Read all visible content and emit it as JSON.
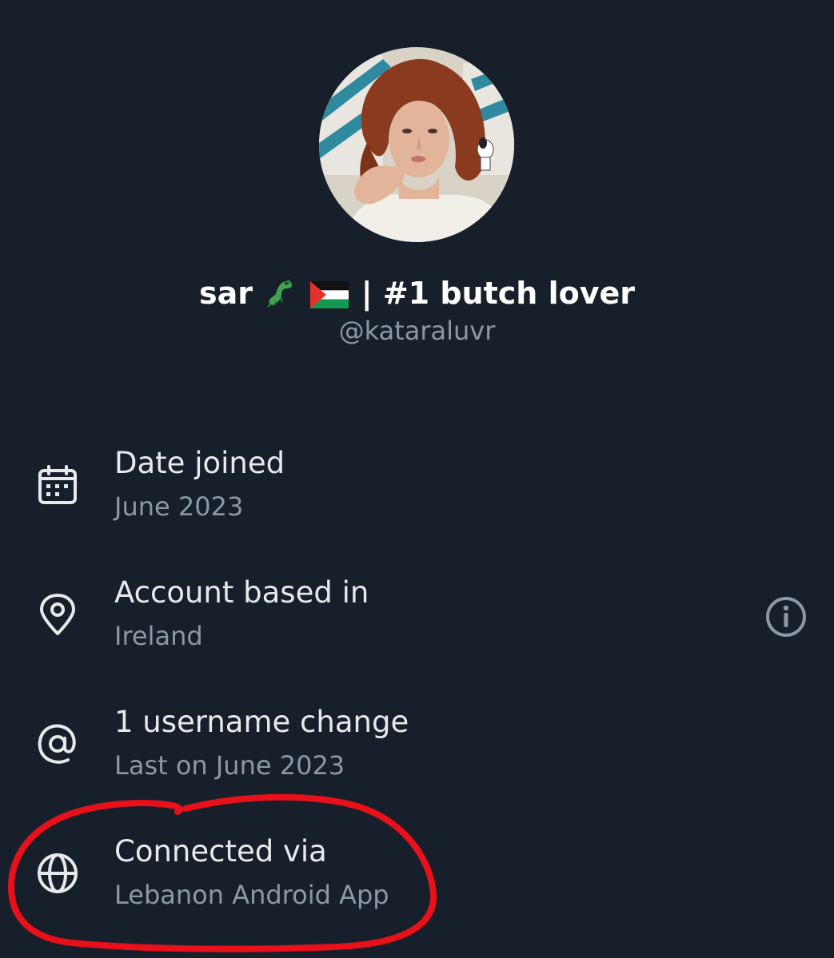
{
  "profile": {
    "display_name_prefix": "sar",
    "display_name_suffix": "| #1 butch lover",
    "emoji_icons": [
      "crocodile-icon",
      "palestine-flag-icon"
    ],
    "handle": "@kataraluvr"
  },
  "info": {
    "date_joined": {
      "label": "Date joined",
      "value": "June 2023",
      "icon": "calendar-icon"
    },
    "account_based": {
      "label": "Account based in",
      "value": "Ireland",
      "icon": "location-pin-icon",
      "action_icon": "info-icon"
    },
    "username_changes": {
      "label": "1 username change",
      "value": "Last on June 2023",
      "icon": "at-sign-icon"
    },
    "connected_via": {
      "label": "Connected via",
      "value": "Lebanon Android App",
      "icon": "globe-icon"
    }
  },
  "colors": {
    "background": "#17202a",
    "primary_text": "#e7e9ea",
    "secondary_text": "#8b98a5",
    "annotation": "#e8101a"
  }
}
